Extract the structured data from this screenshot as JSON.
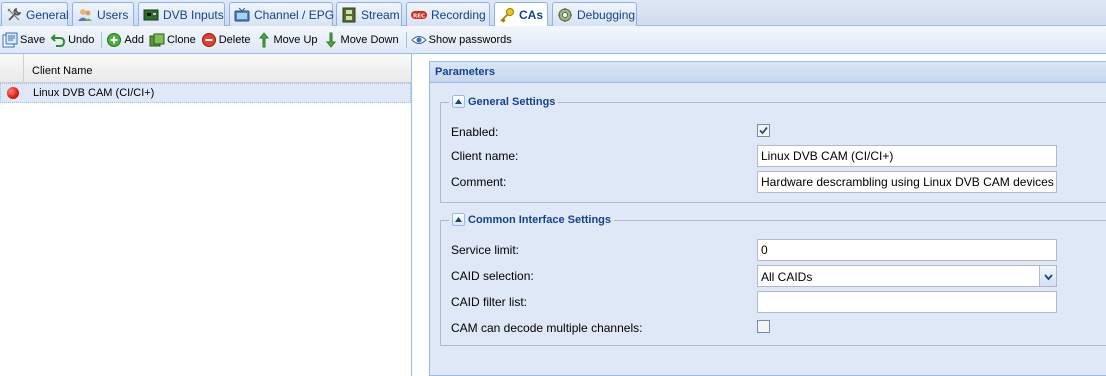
{
  "tabs": [
    {
      "label": "General",
      "icon": "wrench-icon"
    },
    {
      "label": "Users",
      "icon": "users-icon"
    },
    {
      "label": "DVB Inputs",
      "icon": "dvb-card-icon"
    },
    {
      "label": "Channel / EPG",
      "icon": "tv-icon"
    },
    {
      "label": "Stream",
      "icon": "film-icon"
    },
    {
      "label": "Recording",
      "icon": "rec-icon"
    },
    {
      "label": "CAs",
      "icon": "key-icon"
    },
    {
      "label": "Debugging",
      "icon": "bug-icon"
    }
  ],
  "active_tab": "CAs",
  "toolbar": {
    "save": "Save",
    "undo": "Undo",
    "add": "Add",
    "clone": "Clone",
    "delete": "Delete",
    "move_up": "Move Up",
    "move_down": "Move Down",
    "show_passwords": "Show passwords"
  },
  "grid": {
    "column_header": "Client Name",
    "rows": [
      {
        "name": "Linux DVB CAM (CI/CI+)",
        "status": "red"
      }
    ]
  },
  "params": {
    "title": "Parameters",
    "general": {
      "legend": "General Settings",
      "enabled_label": "Enabled:",
      "enabled": true,
      "client_name_label": "Client name:",
      "client_name": "Linux DVB CAM (CI/CI+)",
      "comment_label": "Comment:",
      "comment": "Hardware descrambling using Linux DVB CAM devices"
    },
    "ci": {
      "legend": "Common Interface Settings",
      "service_limit_label": "Service limit:",
      "service_limit": "0",
      "caid_selection_label": "CAID selection:",
      "caid_selection": "All CAIDs",
      "caid_filter_label": "CAID filter list:",
      "caid_filter": "",
      "multi_label": "CAM can decode multiple channels:",
      "multi": false
    }
  },
  "colors": {
    "accent": "#15428b",
    "panel_bg": "#dfe8f6",
    "border": "#99bbe8",
    "status_red": "#e02010"
  }
}
